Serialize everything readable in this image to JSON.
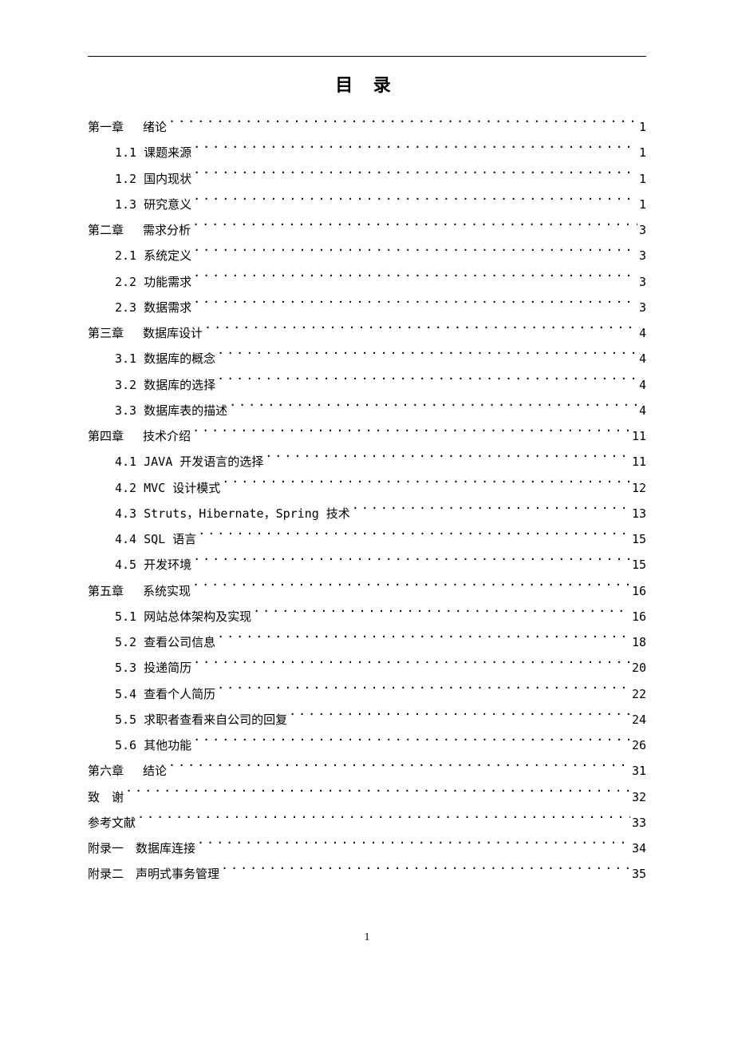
{
  "title": "目  录",
  "page_number": "1",
  "entries": [
    {
      "level": 1,
      "label": "第一章　 绪论",
      "page": "1"
    },
    {
      "level": 2,
      "label": "1.1 课题来源",
      "page": "1"
    },
    {
      "level": 2,
      "label": "1.2 国内现状",
      "page": "1"
    },
    {
      "level": 2,
      "label": "1.3 研究意义",
      "page": "1"
    },
    {
      "level": 1,
      "label": "第二章　 需求分析",
      "page": "3"
    },
    {
      "level": 2,
      "label": "2.1 系统定义",
      "page": "3"
    },
    {
      "level": 2,
      "label": "2.2 功能需求",
      "page": "3"
    },
    {
      "level": 2,
      "label": "2.3 数据需求",
      "page": "3"
    },
    {
      "level": 1,
      "label": "第三章　 数据库设计",
      "page": "4"
    },
    {
      "level": 2,
      "label": "3.1 数据库的概念",
      "page": "4"
    },
    {
      "level": 2,
      "label": "3.2 数据库的选择",
      "page": "4"
    },
    {
      "level": 2,
      "label": "3.3 数据库表的描述",
      "page": "4"
    },
    {
      "level": 1,
      "label": "第四章　 技术介绍",
      "page": "11"
    },
    {
      "level": 2,
      "label": "4.1 JAVA 开发语言的选择 ",
      "page": "11"
    },
    {
      "level": 2,
      "label": "4.2 MVC 设计模式 ",
      "page": "12"
    },
    {
      "level": 2,
      "label": "4.3 Struts，Hibernate，Spring 技术 ",
      "page": "13"
    },
    {
      "level": 2,
      "label": "4.4 SQL 语言 ",
      "page": "15"
    },
    {
      "level": 2,
      "label": "4.5 开发环境",
      "page": "15"
    },
    {
      "level": 1,
      "label": "第五章　 系统实现",
      "page": "16"
    },
    {
      "level": 2,
      "label": "5.1 网站总体架构及实现 ",
      "page": "16"
    },
    {
      "level": 2,
      "label": "5.2 查看公司信息",
      "page": "18"
    },
    {
      "level": 2,
      "label": "5.3 投递简历",
      "page": "20"
    },
    {
      "level": 2,
      "label": "5.4 查看个人简历",
      "page": "22"
    },
    {
      "level": 2,
      "label": "5.5 求职者查看来自公司的回复",
      "page": "24"
    },
    {
      "level": 2,
      "label": "5.6 其他功能",
      "page": "26"
    },
    {
      "level": 1,
      "label": "第六章　 结论",
      "page": "31"
    },
    {
      "level": 1,
      "label": "致　谢 ",
      "page": "32"
    },
    {
      "level": 1,
      "label": "参考文献 ",
      "page": "33"
    },
    {
      "level": 1,
      "label": "附录一　数据库连接 ",
      "page": "34"
    },
    {
      "level": 1,
      "label": "附录二　声明式事务管理 ",
      "page": "35"
    }
  ]
}
